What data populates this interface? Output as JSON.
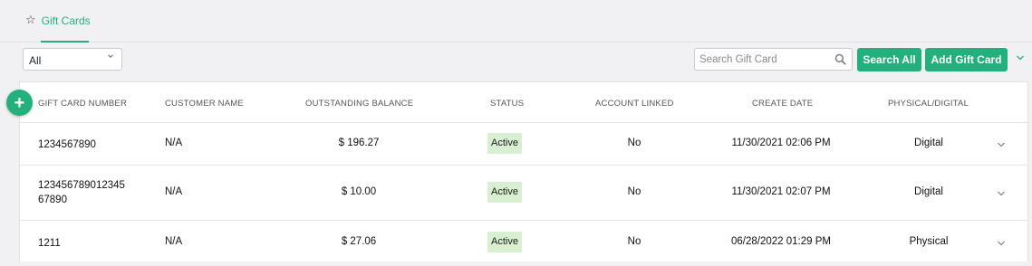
{
  "tab": {
    "label": "Gift Cards",
    "icon": "star-outline-icon"
  },
  "filter": {
    "selected": "All"
  },
  "search": {
    "placeholder": "Search Gift Card",
    "value": ""
  },
  "buttons": {
    "search_all": "Search All",
    "add_gift_card": "Add Gift Card"
  },
  "table": {
    "add_icon": "+",
    "headers": {
      "number": "GIFT CARD NUMBER",
      "customer": "CUSTOMER NAME",
      "balance": "OUTSTANDING BALANCE",
      "status": "STATUS",
      "linked": "ACCOUNT LINKED",
      "date": "CREATE DATE",
      "type": "PHYSICAL/DIGITAL"
    },
    "rows": [
      {
        "number": "1234567890",
        "customer": "N/A",
        "balance": "$ 196.27",
        "status": "Active",
        "linked": "No",
        "date": "11/30/2021 02:06 PM",
        "type": "Digital"
      },
      {
        "number": "123456789012345 67890",
        "customer": "N/A",
        "balance": "$ 10.00",
        "status": "Active",
        "linked": "No",
        "date": "11/30/2021 02:07 PM",
        "type": "Digital"
      },
      {
        "number": "1211",
        "customer": "N/A",
        "balance": "$ 27.06",
        "status": "Active",
        "linked": "No",
        "date": "06/28/2022 01:29 PM",
        "type": "Physical"
      }
    ]
  },
  "colors": {
    "accent": "#22b07d",
    "status_bg": "#d8f0d1",
    "page_bg": "#f1f1f3"
  }
}
